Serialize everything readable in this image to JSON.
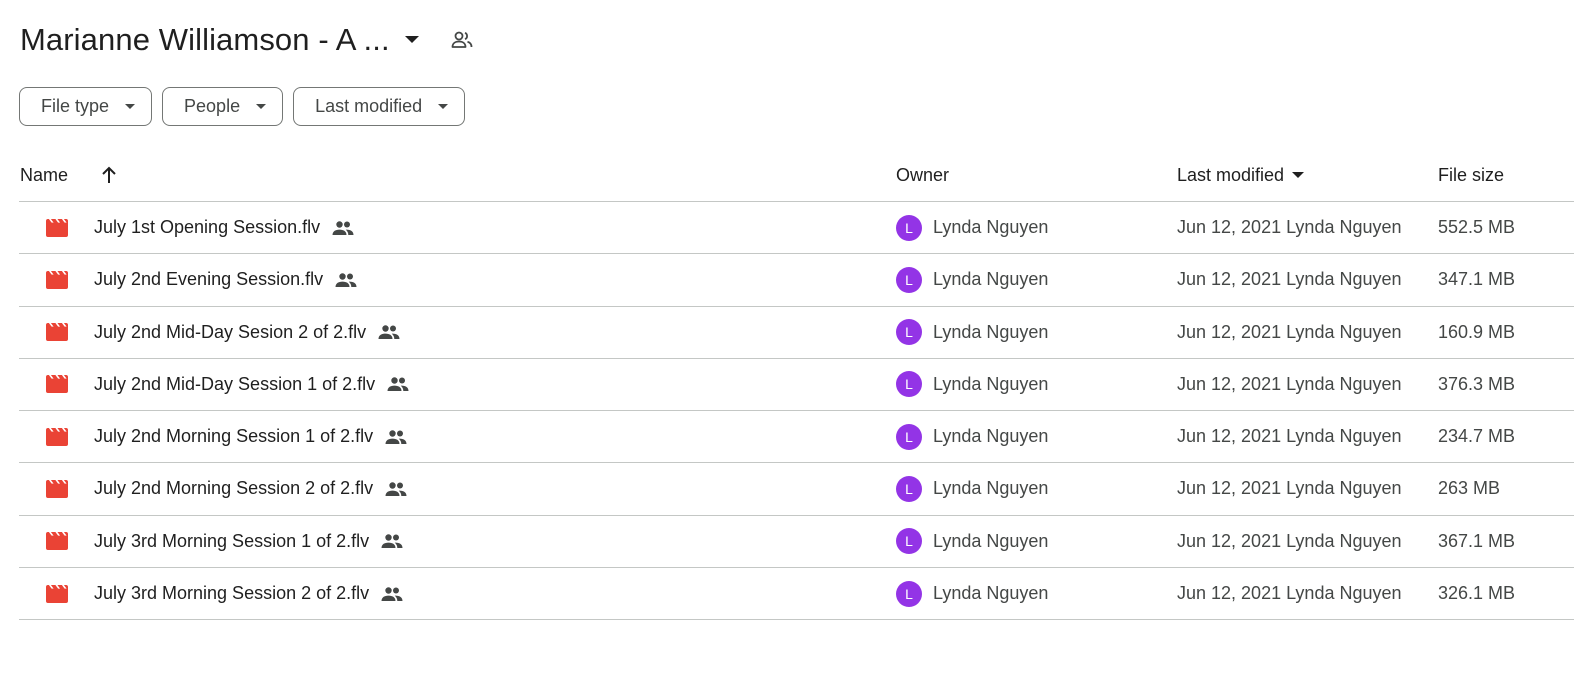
{
  "header": {
    "title": "Marianne Williamson - A ...",
    "title_caret_icon": "arrow-drop-down-icon",
    "share_icon": "people-outline-icon"
  },
  "filters": [
    {
      "label": "File type"
    },
    {
      "label": "People"
    },
    {
      "label": "Last modified"
    }
  ],
  "columns": {
    "name": "Name",
    "owner": "Owner",
    "last_modified": "Last modified",
    "file_size": "File size",
    "sort_icon": "arrow-up-icon"
  },
  "files": [
    {
      "name": "July 1st Opening Session.flv",
      "owner": "Lynda Nguyen",
      "owner_initial": "L",
      "modified": "Jun 12, 2021 Lynda Nguyen",
      "size": "552.5 MB"
    },
    {
      "name": "July 2nd Evening Session.flv",
      "owner": "Lynda Nguyen",
      "owner_initial": "L",
      "modified": "Jun 12, 2021 Lynda Nguyen",
      "size": "347.1 MB"
    },
    {
      "name": "July 2nd Mid-Day Sesion 2 of 2.flv",
      "owner": "Lynda Nguyen",
      "owner_initial": "L",
      "modified": "Jun 12, 2021 Lynda Nguyen",
      "size": "160.9 MB"
    },
    {
      "name": "July 2nd Mid-Day Session  1 of 2.flv",
      "owner": "Lynda Nguyen",
      "owner_initial": "L",
      "modified": "Jun 12, 2021 Lynda Nguyen",
      "size": "376.3 MB"
    },
    {
      "name": "July 2nd Morning Session  1 of 2.flv",
      "owner": "Lynda Nguyen",
      "owner_initial": "L",
      "modified": "Jun 12, 2021 Lynda Nguyen",
      "size": "234.7 MB"
    },
    {
      "name": "July 2nd Morning Session  2 of 2.flv",
      "owner": "Lynda Nguyen",
      "owner_initial": "L",
      "modified": "Jun 12, 2021 Lynda Nguyen",
      "size": "263 MB"
    },
    {
      "name": "July 3rd Morning Session  1 of 2.flv",
      "owner": "Lynda Nguyen",
      "owner_initial": "L",
      "modified": "Jun 12, 2021 Lynda Nguyen",
      "size": "367.1 MB"
    },
    {
      "name": "July 3rd Morning Session  2 of 2.flv",
      "owner": "Lynda Nguyen",
      "owner_initial": "L",
      "modified": "Jun 12, 2021 Lynda Nguyen",
      "size": "326.1 MB"
    }
  ],
  "icons": {
    "file_type_icon": "video-file-icon",
    "shared_icon": "people-icon"
  },
  "colors": {
    "video_icon": "#ea4335",
    "avatar": "#9334e6",
    "divider": "#c4c7c5"
  }
}
